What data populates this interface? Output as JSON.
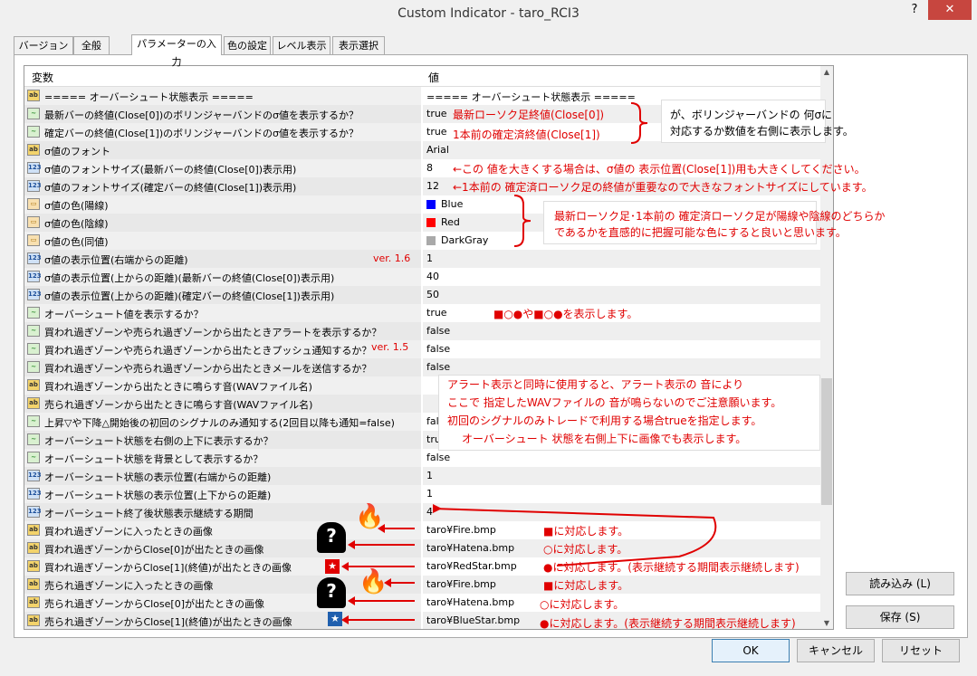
{
  "window": {
    "title": "Custom Indicator - taro_RCI3",
    "help": "?",
    "close": "✕"
  },
  "tabs": [
    "バージョン情報",
    "全般",
    "パラメーターの入力",
    "色の設定",
    "レベル表示",
    "表示選択"
  ],
  "grid": {
    "col_variable": "変数",
    "col_value": "値"
  },
  "rows": [
    {
      "icon": "ab",
      "name": "===== オーバーシュート状態表示 =====",
      "value": "===== オーバーシュート状態表示 ====="
    },
    {
      "icon": "bool",
      "name": "最新バーの終値(Close[0])のボリンジャーバンドのσ値を表示するか？",
      "value": "true"
    },
    {
      "icon": "bool",
      "name": "確定バーの終値(Close[1])のボリンジャーバンドのσ値を表示するか？",
      "value": "true"
    },
    {
      "icon": "ab",
      "name": "σ値のフォント",
      "value": "Arial"
    },
    {
      "icon": "num",
      "name": "σ値のフォントサイズ(最新バーの終値(Close[0])表示用)",
      "value": "8"
    },
    {
      "icon": "num",
      "name": "σ値のフォントサイズ(確定バーの終値(Close[1])表示用)",
      "value": "12"
    },
    {
      "icon": "col",
      "name": "σ値の色(陽線)",
      "value": "Blue",
      "swatch": "#0000ff"
    },
    {
      "icon": "col",
      "name": "σ値の色(陰線)",
      "value": "Red",
      "swatch": "#ff0000"
    },
    {
      "icon": "col",
      "name": "σ値の色(同値)",
      "value": "DarkGray",
      "swatch": "#a9a9a9"
    },
    {
      "icon": "num",
      "name": "σ値の表示位置(右端からの距離)",
      "value": "1"
    },
    {
      "icon": "num",
      "name": "σ値の表示位置(上からの距離)(最新バーの終値(Close[0])表示用)",
      "value": "40"
    },
    {
      "icon": "num",
      "name": "σ値の表示位置(上からの距離)(確定バーの終値(Close[1])表示用)",
      "value": "50"
    },
    {
      "icon": "bool",
      "name": "オーバーシュート値を表示するか？",
      "value": "true"
    },
    {
      "icon": "bool",
      "name": "買われ過ぎゾーンや売られ過ぎゾーンから出たときアラートを表示するか？",
      "value": "false"
    },
    {
      "icon": "bool",
      "name": "買われ過ぎゾーンや売られ過ぎゾーンから出たときプッシュ通知するか？",
      "value": "false"
    },
    {
      "icon": "bool",
      "name": "買われ過ぎゾーンや売られ過ぎゾーンから出たときメールを送信するか？",
      "value": "false"
    },
    {
      "icon": "ab",
      "name": "買われ過ぎゾーンから出たときに鳴らす音(WAVファイル名)",
      "value": ""
    },
    {
      "icon": "ab",
      "name": "売られ過ぎゾーンから出たときに鳴らす音(WAVファイル名)",
      "value": ""
    },
    {
      "icon": "bool",
      "name": "上昇▽や下降△開始後の初回のシグナルのみ通知する(2回目以降も通知=false)",
      "value": "false"
    },
    {
      "icon": "bool",
      "name": "オーバーシュート状態を右側の上下に表示するか？",
      "value": "true"
    },
    {
      "icon": "bool",
      "name": "オーバーシュート状態を背景として表示するか？",
      "value": "false"
    },
    {
      "icon": "num",
      "name": "オーバーシュート状態の表示位置(右端からの距離)",
      "value": "1"
    },
    {
      "icon": "num",
      "name": "オーバーシュート状態の表示位置(上下からの距離)",
      "value": "1"
    },
    {
      "icon": "num",
      "name": "オーバーシュート終了後状態表示継続する期間",
      "value": "4"
    },
    {
      "icon": "ab",
      "name": "買われ過ぎゾーンに入ったときの画像",
      "value": "taro¥Fire.bmp"
    },
    {
      "icon": "ab",
      "name": "買われ過ぎゾーンからClose[0]が出たときの画像",
      "value": "taro¥Hatena.bmp"
    },
    {
      "icon": "ab",
      "name": "買われ過ぎゾーンからClose[1](終値)が出たときの画像",
      "value": "taro¥RedStar.bmp"
    },
    {
      "icon": "ab",
      "name": "売られ過ぎゾーンに入ったときの画像",
      "value": "taro¥Fire.bmp"
    },
    {
      "icon": "ab",
      "name": "売られ過ぎゾーンからClose[0]が出たときの画像",
      "value": "taro¥Hatena.bmp"
    },
    {
      "icon": "ab",
      "name": "売られ過ぎゾーンからClose[1](終値)が出たときの画像",
      "value": "taro¥BlueStar.bmp"
    }
  ],
  "annotations": {
    "latest_close": "最新ローソク足終値(Close[0])",
    "prev_close": "1本前の確定済終値(Close[1])",
    "bb_note_1": "が、ボリンジャーバンドの 何σに",
    "bb_note_2": "対応するか数値を右側に表示します。",
    "font_note_1": "←この 値を大きくする場合は、σ値の 表示位置(Close[1])用も大きくしてください。",
    "font_note_2": "←1本前の 確定済ローソク足の終値が重要なので大きなフォントサイズにしています。",
    "color_note_1": "最新ローソク足･1本前の 確定済ローソク足が陽線や陰線のどちらか",
    "color_note_2": "であるかを直感的に把握可能な色にすると良いと思います。",
    "ver16": "ver. 1.6",
    "ver15": "ver. 1.5",
    "overshoot_pre": "■○●や■○●を表示します。",
    "alert_1": "アラート表示と同時に使用すると、アラート表示の 音により",
    "alert_2": "ここで 指定したWAVファイルの 音が鳴らないのでご注意願います。",
    "alert_3": "初回のシグナルのみトレードで利用する場合trueを指定します。",
    "alert_4": "オーバーシュート 状態を右側上下に画像でも表示します。",
    "img1": "■に対応します。",
    "img2": "○に対応します。",
    "img3": "●に対応します。(表示継続する期間表示継続します)",
    "img4": "■に対応します。",
    "img5": "○に対応します。",
    "img6": "●に対応します。(表示継続する期間表示継続します)"
  },
  "buttons": {
    "load": "読み込み (L)",
    "save": "保存 (S)",
    "ok": "OK",
    "cancel": "キャンセル",
    "reset": "リセット"
  },
  "colors": {
    "annotation": "#e00000",
    "blue": "#0000e0"
  }
}
